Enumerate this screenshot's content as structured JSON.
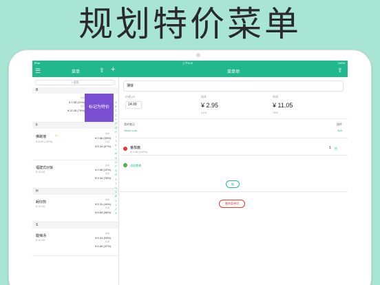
{
  "headline": "规划特价菜单",
  "status": {
    "carrier": "iPad",
    "time": "上午9:41",
    "battery": "100%"
  },
  "left_nav": {
    "title": "菜单",
    "menu_icon": "list-icon",
    "share_icon": "share-icon",
    "add_icon": "plus-icon"
  },
  "search": {
    "placeholder": "搜索"
  },
  "swipe_action": "标记为特价",
  "sections": [
    {
      "letter": "B",
      "items": [
        {
          "name": "",
          "price": "",
          "profit_note": "",
          "cost_label": "成本",
          "cost": "¥ 2.95 (21%)",
          "profit_label": "利润",
          "profit": "¥ 11.05 (79%)"
        }
      ]
    },
    {
      "letter": "F",
      "items": [
        {
          "name": "佛跳墙",
          "price": "¥ 8.00 (-20%)",
          "cost_label": "成本",
          "cost": "¥ 2.66 (33%)",
          "profit_label": "利润",
          "profit": "¥ 5.34 (67%)"
        },
        {
          "name": "福建式炒饭",
          "price": "¥ 12.00",
          "cost_label": "成本",
          "cost": "¥ 2.66 (22%)",
          "profit_label": "利润",
          "profit": "¥ 9.34 (78%)"
        }
      ]
    },
    {
      "letter": "H",
      "items": [
        {
          "name": "蚵仔煎",
          "price": "¥ 12.00",
          "cost_label": "成本",
          "cost": "¥ 5.31 (44%)",
          "profit_label": "利润",
          "profit": "¥ 6.69 (56%)"
        }
      ]
    },
    {
      "letter": "S",
      "items": [
        {
          "name": "酸辣汤",
          "price": "¥ 10.00",
          "cost_label": "成本",
          "cost": "¥ 5.31 (53%)",
          "profit_label": "利润",
          "profit": "¥ 4.69 (47%)"
        }
      ]
    }
  ],
  "index_letters": [
    "A",
    "B",
    "C",
    "D",
    "E",
    "F",
    "G",
    "H",
    "I",
    "J",
    "K",
    "L",
    "M",
    "N",
    "O",
    "P",
    "Q",
    "R",
    "S",
    "T",
    "U",
    "V",
    "W",
    "X",
    "Y",
    "Z",
    "#"
  ],
  "detail": {
    "title": "菜单项",
    "share_icon": "share-icon",
    "dish_name": "薄饼",
    "price_label": "价格 (¥)",
    "price_value": "14.00",
    "cost_label": "成本",
    "cost_value": "¥ 2.95",
    "cost_pct": "21%",
    "profit_label": "利润",
    "profit_value": "¥ 11.05",
    "profit_pct": "79%",
    "notes_label": "我的笔记",
    "notes_value": "Serve cold.",
    "photo_label": "插件",
    "photo_value": "N/A",
    "ingredient_name": "番茄酱",
    "ingredient_cost": "¥ 2.95 (100%)",
    "ingredient_qty": "1",
    "ingredient_unit": "份",
    "add_ingredient": "添加食谱",
    "edit_button": "链",
    "delete_button": "删除菜单项",
    "colors": {
      "accent": "#22b88d",
      "ingredient_dot": "#e53935",
      "add_dot": "#4caf50",
      "delete": "#e53935"
    }
  }
}
